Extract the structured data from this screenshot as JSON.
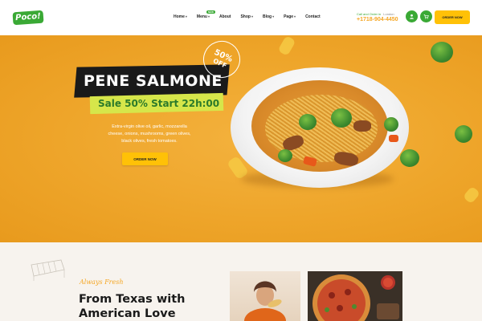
{
  "brand": {
    "logo_text": "Poco!"
  },
  "nav": {
    "items": [
      {
        "label": "Home",
        "has_caret": true
      },
      {
        "label": "Menu",
        "has_caret": true,
        "badge": "NEW"
      },
      {
        "label": "About",
        "has_caret": false
      },
      {
        "label": "Shop",
        "has_caret": true
      },
      {
        "label": "Blog",
        "has_caret": true
      },
      {
        "label": "Page",
        "has_caret": true
      },
      {
        "label": "Contact",
        "has_caret": false
      }
    ],
    "caret_glyph": "▾"
  },
  "header": {
    "call_label": "Call and Order in",
    "city": "London",
    "phone": "+1718-904-4450",
    "user_icon": "user-icon",
    "cart_icon": "cart-icon",
    "order_button": "ORDER NOW"
  },
  "hero": {
    "title": "PENE SALMONE",
    "sale": "Sale 50% Start 22h:00",
    "badge_percent": "50%",
    "badge_off": "OFF",
    "description": "Extra-virgin olive oil, garlic, mozzarella cheese, onions, mushrooms, green olives, black olives, fresh tomatoes.",
    "order_button": "ORDER NOW"
  },
  "about": {
    "kicker": "Always Fresh",
    "title_line1": "From Texas with",
    "title_line2": "American Love"
  },
  "colors": {
    "brand_green": "#3aa935",
    "accent_yellow": "#ffc107",
    "hero_orange": "#eea52a",
    "phone_orange": "#f5a623"
  }
}
